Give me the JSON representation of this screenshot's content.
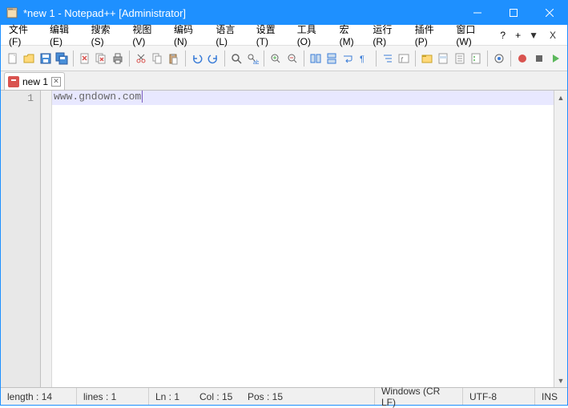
{
  "titlebar": {
    "title": "*new 1 - Notepad++ [Administrator]"
  },
  "menubar": {
    "items": [
      "文件(F)",
      "编辑(E)",
      "搜索(S)",
      "视图(V)",
      "编码(N)",
      "语言(L)",
      "设置(T)",
      "工具(O)",
      "宏(M)",
      "运行(R)",
      "插件(P)",
      "窗口(W)",
      "?"
    ],
    "plus": "+",
    "overflow": "▼",
    "x": "X"
  },
  "tab": {
    "name": "new 1"
  },
  "editor": {
    "line_number": "1",
    "content": "www.gndown.com"
  },
  "status": {
    "length": "length : 14",
    "lines": "lines : 1",
    "ln": "Ln : 1",
    "col": "Col : 15",
    "pos": "Pos : 15",
    "eol": "Windows (CR LF)",
    "encoding": "UTF-8",
    "ins": "INS"
  }
}
